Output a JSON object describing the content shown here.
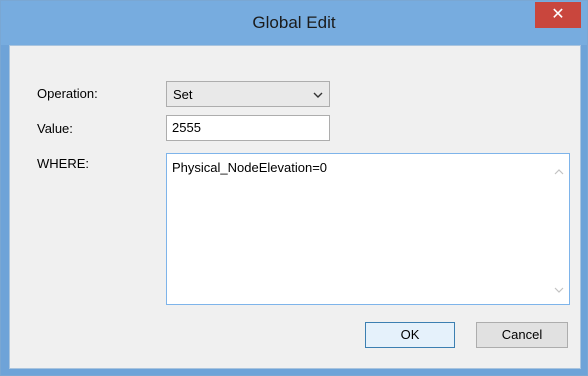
{
  "dialog": {
    "title": "Global Edit",
    "close_glyph": "✕"
  },
  "form": {
    "operation_label": "Operation:",
    "operation_value": "Set",
    "value_label": "Value:",
    "value_text": "2555",
    "where_label": "WHERE:",
    "where_text": "Physical_NodeElevation=0"
  },
  "buttons": {
    "ok_label": "OK",
    "cancel_label": "Cancel"
  },
  "colors": {
    "titlebar": "#77acdf",
    "close_button": "#c9463d",
    "client_background": "#f0f0f0"
  }
}
